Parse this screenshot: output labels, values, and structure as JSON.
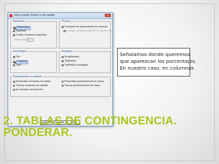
{
  "dialog": {
    "title": "Tabla cruzada: Mostrar en las casillas",
    "close_label": "X",
    "counts_group": {
      "label": "Recuentos",
      "items": [
        {
          "label": "Observado",
          "checked": true
        },
        {
          "label": "Esperado",
          "checked": false
        },
        {
          "label": "Ocultar recuentos pequeños",
          "checked": false
        }
      ],
      "less_than_label": "Menor que",
      "less_than_value": "5"
    },
    "z_test_group": {
      "label": "Prueba z",
      "items": [
        {
          "label": "Comparar las proporciones de columna",
          "checked": false
        },
        {
          "label": "Corregir valores p (método de Bonferroni)",
          "checked": false
        }
      ]
    },
    "percentages_group": {
      "label": "Porcentajes",
      "items": [
        {
          "label": "Fila",
          "checked": false
        },
        {
          "label": "Columna",
          "checked": true
        },
        {
          "label": "Total",
          "checked": false
        }
      ]
    },
    "residuals_group": {
      "label": "Residuos",
      "items": [
        {
          "label": "No tipificados",
          "checked": false
        },
        {
          "label": "Tipificados",
          "checked": false
        },
        {
          "label": "Tipificados corregidos",
          "checked": false
        }
      ]
    },
    "weights_group": {
      "label": "Ponderaciones no enteras",
      "items": [
        {
          "label": "Redondear recuentos de casilla",
          "selected": true
        },
        {
          "label": "Redondear ponderaciones de casos",
          "selected": false
        },
        {
          "label": "Truncar recuentos de casillas",
          "selected": false
        },
        {
          "label": "Truncar ponderaciones de casos",
          "selected": false
        },
        {
          "label": "No efectuar correcciones",
          "selected": false
        }
      ]
    },
    "buttons": {
      "continue": "Continuar",
      "cancel": "Cancelar",
      "help": "Ayuda"
    }
  },
  "callout": {
    "line1": "Señalamos donde queremos",
    "line2": "que aparezcan los porcentajes.",
    "line3_prefix": "En nuestro caso, en ",
    "line3_emphasis": "columnas",
    "line3_suffix": "."
  },
  "slide_title": {
    "line1": "2. TABLAS DE CONTINGENCIA.",
    "line2": "PONDERAR."
  },
  "colors": {
    "title_green": "#a9c61e",
    "dialog_accent": "#1f3f8f",
    "close_red": "#c9463d"
  }
}
